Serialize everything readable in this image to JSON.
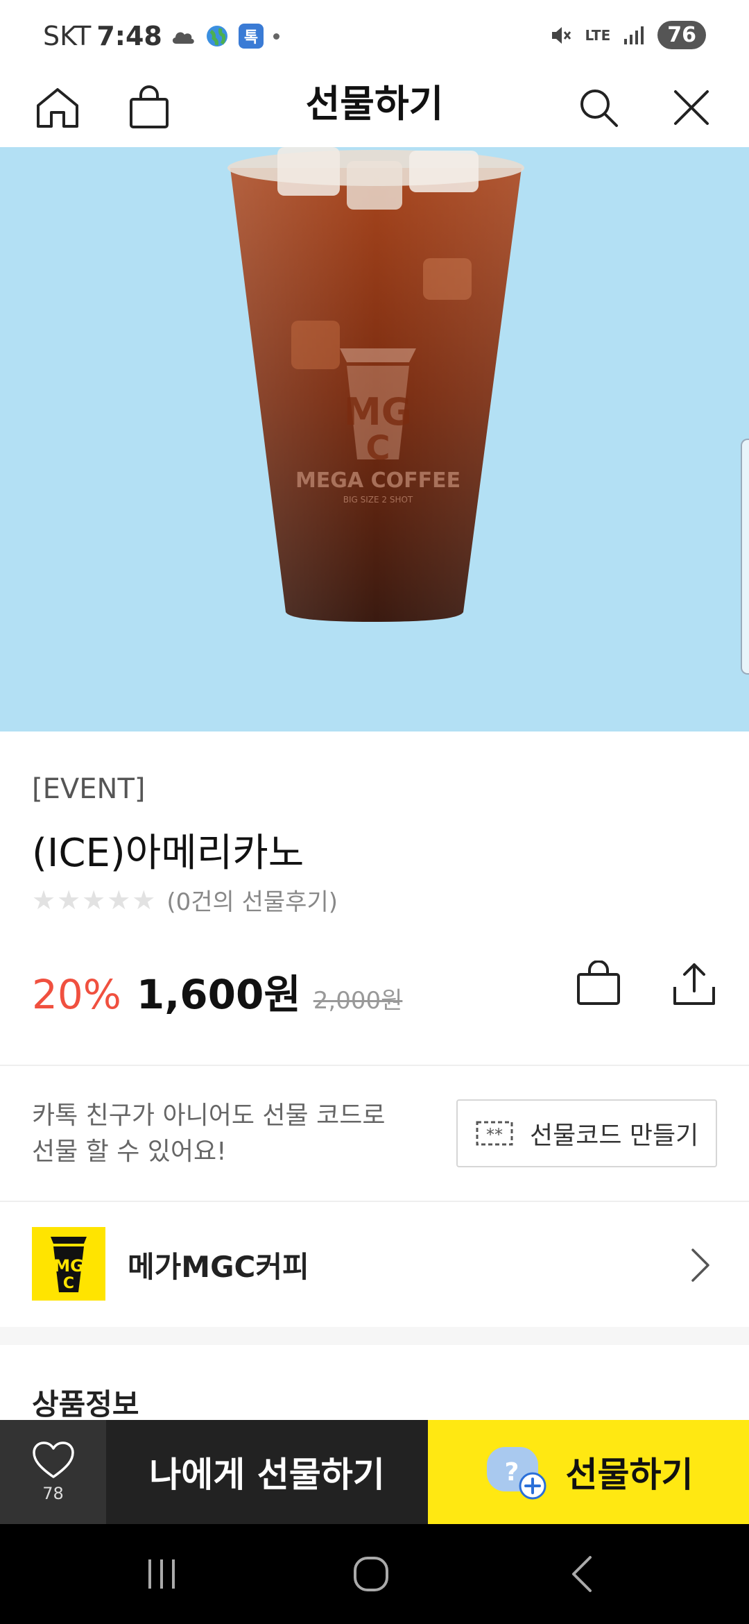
{
  "status_bar": {
    "carrier": "SKT",
    "time": "7:48",
    "kakao_badge": "톡",
    "network": "LTE",
    "battery": "76"
  },
  "header": {
    "title": "선물하기"
  },
  "product": {
    "event_tag": "[EVENT]",
    "name": "(ICE)아메리카노",
    "stars": "★★★★★",
    "review_count": "(0건의 선물후기)",
    "discount": "20%",
    "price": "1,600원",
    "original_price": "2,000원"
  },
  "gift_code": {
    "text_line1": "카톡 친구가 아니어도 선물 코드로",
    "text_line2": "선물 할 수 있어요!",
    "button_label": "선물코드 만들기"
  },
  "brand": {
    "name": "메가MGC커피"
  },
  "section": {
    "title": "상품정보"
  },
  "action_bar": {
    "like_count": "78",
    "self_gift_label": "나에게 선물하기",
    "gift_label": "선물하기"
  },
  "colors": {
    "accent_yellow": "#ffe812",
    "discount_red": "#f0503f",
    "hero_bg": "#b3e0f4",
    "brand_yellow": "#ffe400"
  }
}
